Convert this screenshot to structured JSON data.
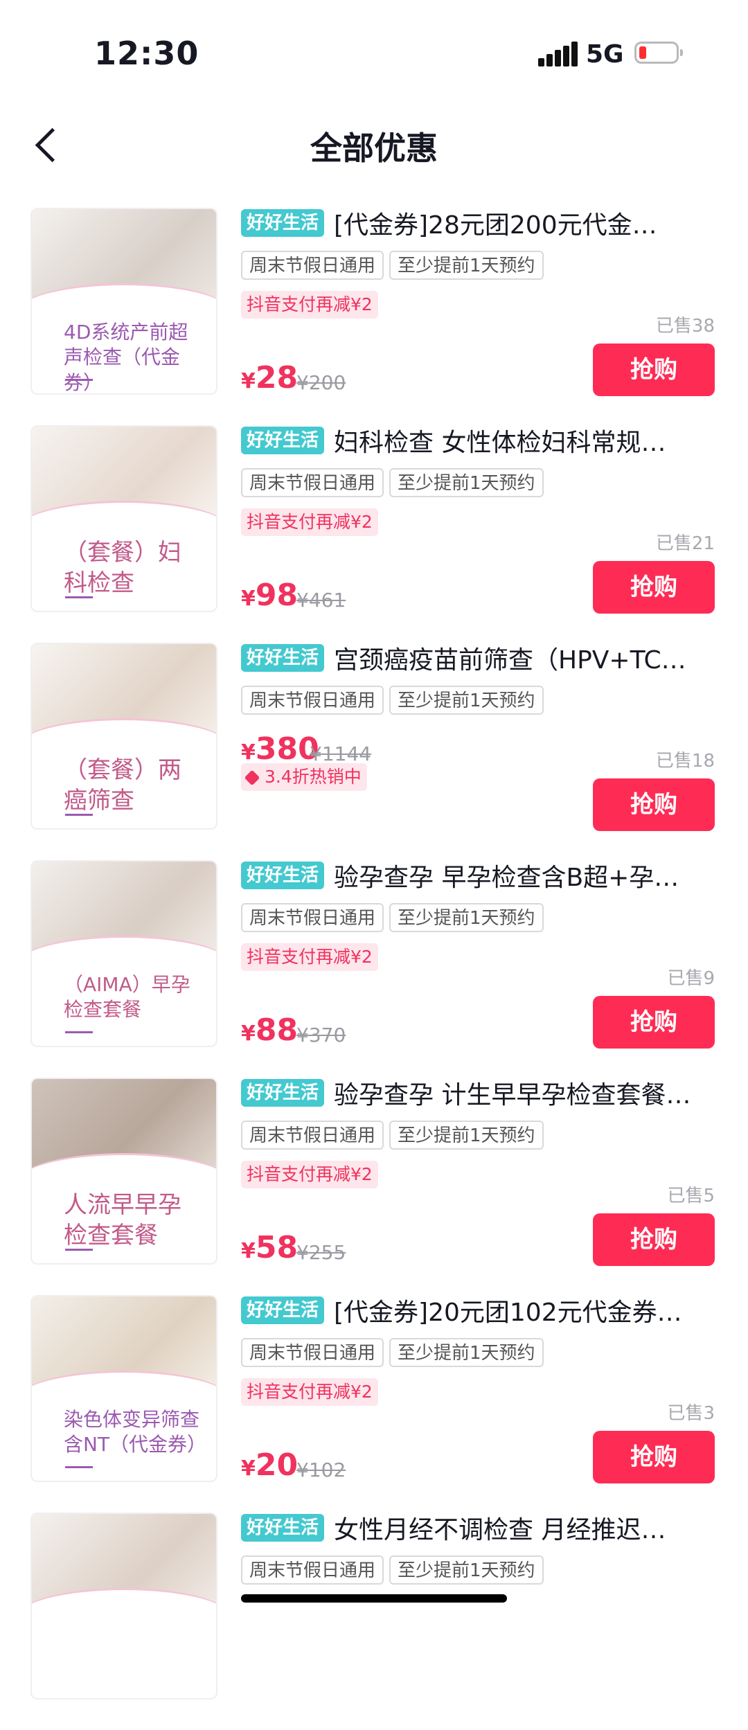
{
  "status_bar": {
    "time": "12:30",
    "network": "5G"
  },
  "header": {
    "title": "全部优惠"
  },
  "common": {
    "brand_tag": "好好生活",
    "chip_weekend": "周末节假日通用",
    "chip_booking": "至少提前1天预约",
    "buy_label": "抢购",
    "yen": "¥",
    "promo": "抖音支付再减¥2"
  },
  "items": [
    {
      "title": "[代金券]28元团200元代金…",
      "thumb_text": "4D系统产前超声检查（代金券）",
      "sold": "已售38",
      "price": "28",
      "orig_price": "¥200"
    },
    {
      "title": "妇科检查 女性体检妇科常规…",
      "thumb_text": "（套餐）妇科检查",
      "sold": "已售21",
      "price": "98",
      "orig_price": "¥461"
    },
    {
      "title": "宫颈癌疫苗前筛查（HPV+TC…",
      "thumb_text": "（套餐）两癌筛查",
      "sold": "已售18",
      "price": "380",
      "orig_price": "¥1144",
      "discount": "3.4折热销中"
    },
    {
      "title": "验孕查孕 早孕检查含B超+孕…",
      "thumb_text": "（AIMA）早孕检查套餐",
      "sold": "已售9",
      "price": "88",
      "orig_price": "¥370"
    },
    {
      "title": "验孕查孕 计生早早孕检查套餐…",
      "thumb_text": "人流早早孕检查套餐",
      "sold": "已售5",
      "price": "58",
      "orig_price": "¥255"
    },
    {
      "title": "[代金券]20元团102元代金券…",
      "thumb_text": "染色体变异筛查含NT（代金券）",
      "sold": "已售3",
      "price": "20",
      "orig_price": "¥102"
    },
    {
      "title": "女性月经不调检查 月经推迟…"
    }
  ]
}
